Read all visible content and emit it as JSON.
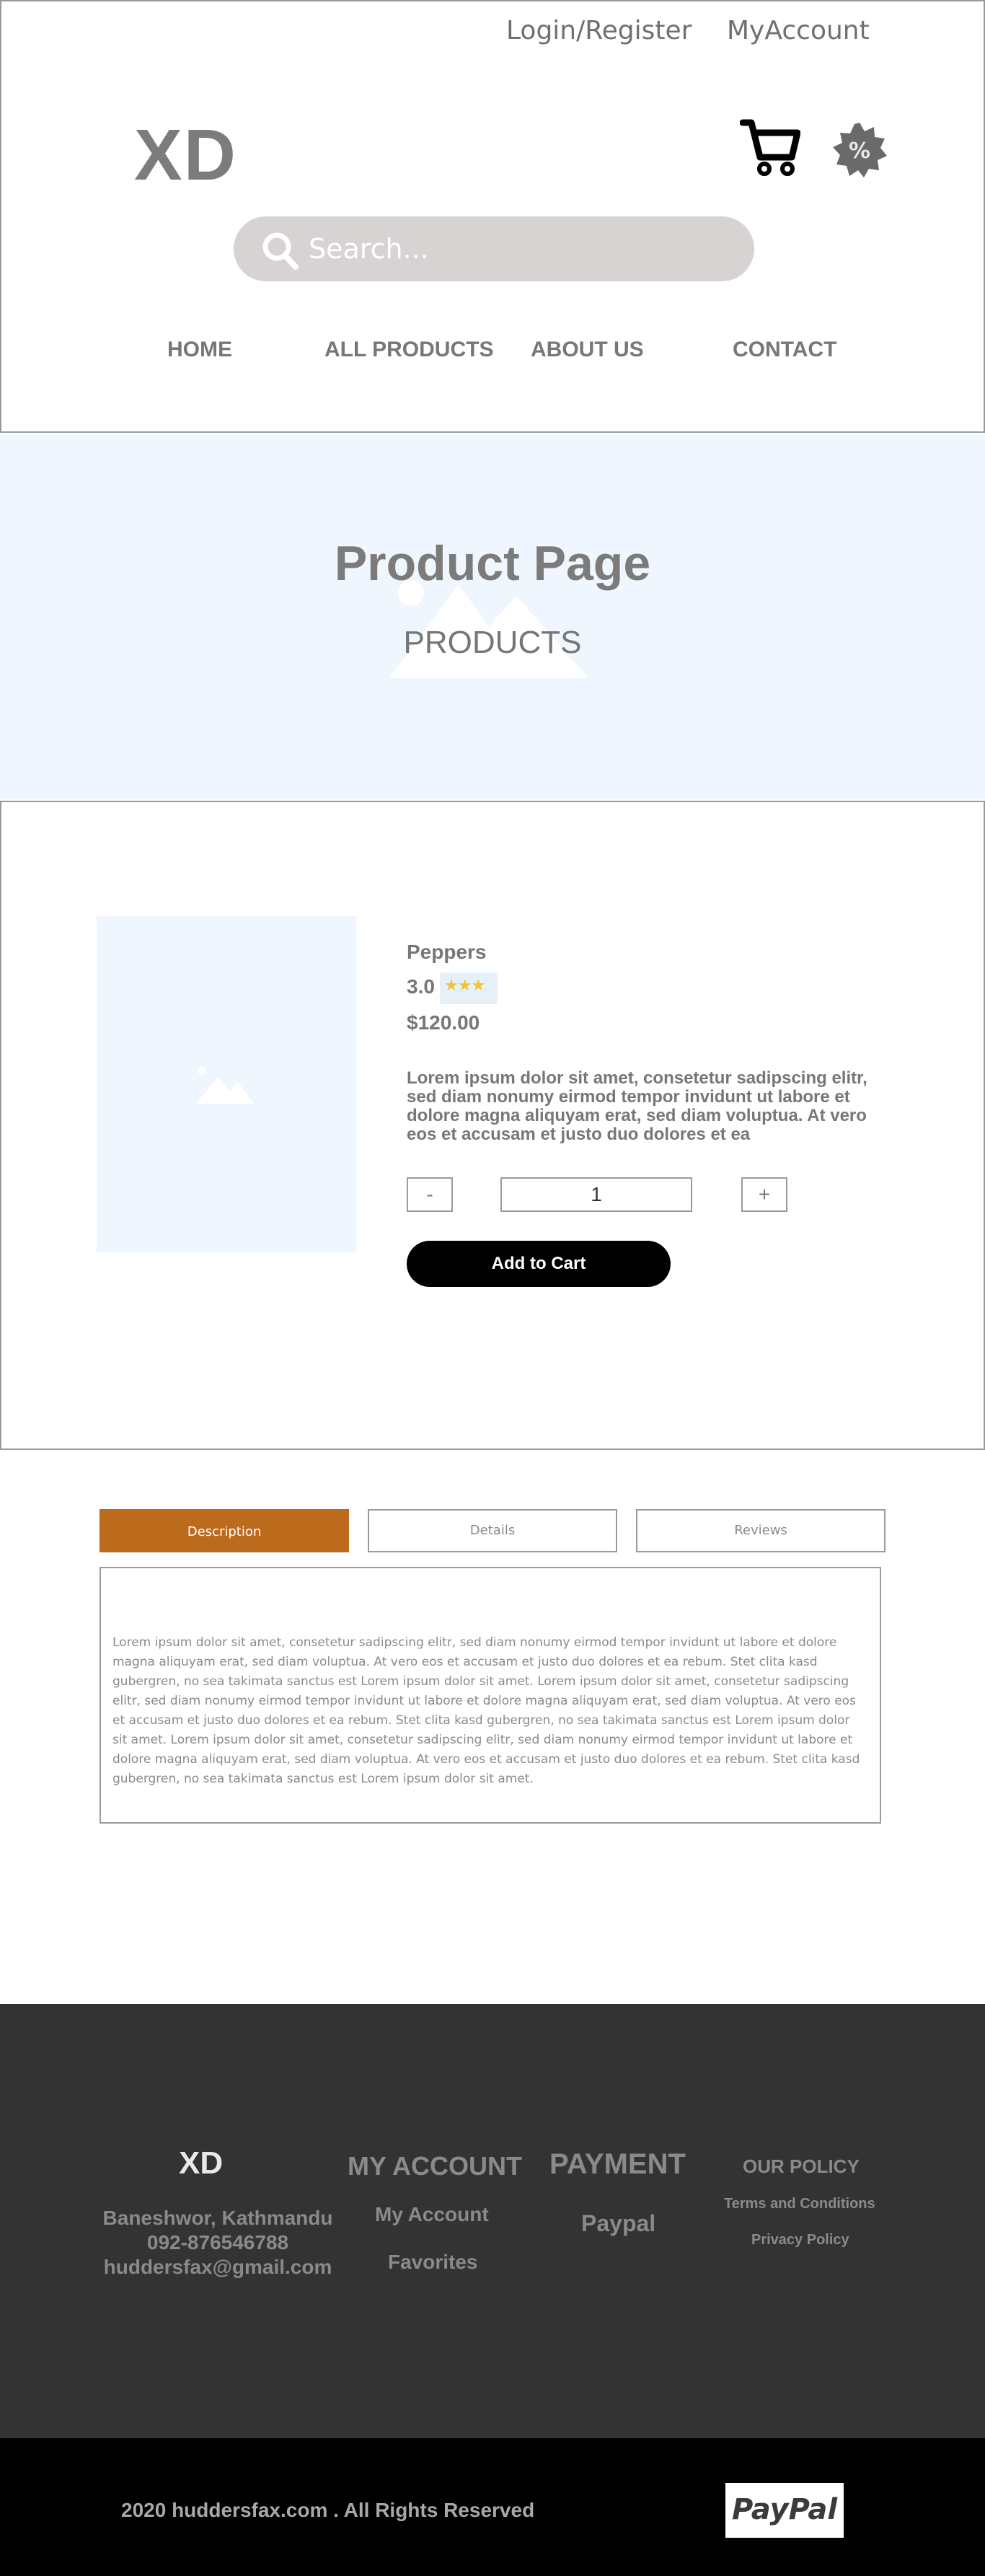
{
  "topbar": {
    "login": "Login/Register",
    "account": "MyAccount"
  },
  "header": {
    "logo": "XD",
    "icons": {
      "cart": "cart-icon",
      "discount": "percent-badge-icon",
      "search": "search-icon"
    },
    "search_placeholder": "Search...",
    "nav": [
      "HOME",
      "ALL PRODUCTS",
      "ABOUT US",
      "CONTACT"
    ]
  },
  "hero": {
    "title": "Product Page",
    "subtitle": "PRODUCTS"
  },
  "product": {
    "name": "Peppers",
    "rating": "3.0",
    "stars": "★★★",
    "rating_value": 3,
    "price": "$120.00",
    "description": "Lorem ipsum dolor sit amet, consetetur sadipscing elitr, sed diam nonumy eirmod tempor invidunt ut labore et dolore magna aliquyam erat, sed diam voluptua. At vero eos et accusam et justo duo dolores et ea",
    "qty_minus": "-",
    "qty_plus": "+",
    "quantity": "1",
    "add_to_cart": "Add to  Cart"
  },
  "tabs": {
    "items": [
      "Description",
      "Details",
      "Reviews"
    ],
    "active": "Description",
    "content": "Lorem ipsum dolor sit amet, consetetur sadipscing elitr, sed diam nonumy eirmod tempor invidunt ut labore et dolore magna aliquyam erat, sed diam voluptua. At vero eos et accusam et justo duo dolores et ea rebum. Stet clita kasd gubergren, no sea takimata sanctus est Lorem ipsum dolor sit amet. Lorem ipsum dolor sit amet, consetetur sadipscing elitr, sed diam nonumy eirmod tempor invidunt ut labore et dolore magna aliquyam erat, sed diam voluptua. At vero eos et accusam et justo duo dolores et ea rebum. Stet clita kasd gubergren, no sea takimata sanctus est Lorem ipsum dolor sit amet. Lorem ipsum dolor sit amet, consetetur sadipscing elitr, sed diam nonumy eirmod tempor invidunt ut labore et dolore magna aliquyam erat, sed diam voluptua. At vero eos et accusam et justo duo dolores et ea rebum. Stet clita kasd gubergren, no sea takimata sanctus est Lorem ipsum dolor sit amet."
  },
  "footer": {
    "logo": "XD",
    "address": "Baneshwor, Kathmandu",
    "phone": "092-876546788",
    "email": "huddersfax@gmail.com",
    "my_account": {
      "title": "MY ACCOUNT",
      "links": [
        "My Account",
        "Favorites"
      ]
    },
    "payment": {
      "title": "PAYMENT",
      "links": [
        "Paypal"
      ]
    },
    "policy": {
      "title": "OUR POLICY",
      "links": [
        "Terms and Conditions",
        "Privacy Policy"
      ]
    },
    "copyright": "2020 huddersfax.com . All Rights Reserved",
    "paypal_badge": "PayPal"
  },
  "colors": {
    "accent_tab": "#bc6b1c",
    "hero_bg": "#eff6fd",
    "footer_bg": "#333333",
    "bottom_bg": "#000000",
    "search_bg": "#d6d3d2",
    "star": "#f1c232"
  }
}
